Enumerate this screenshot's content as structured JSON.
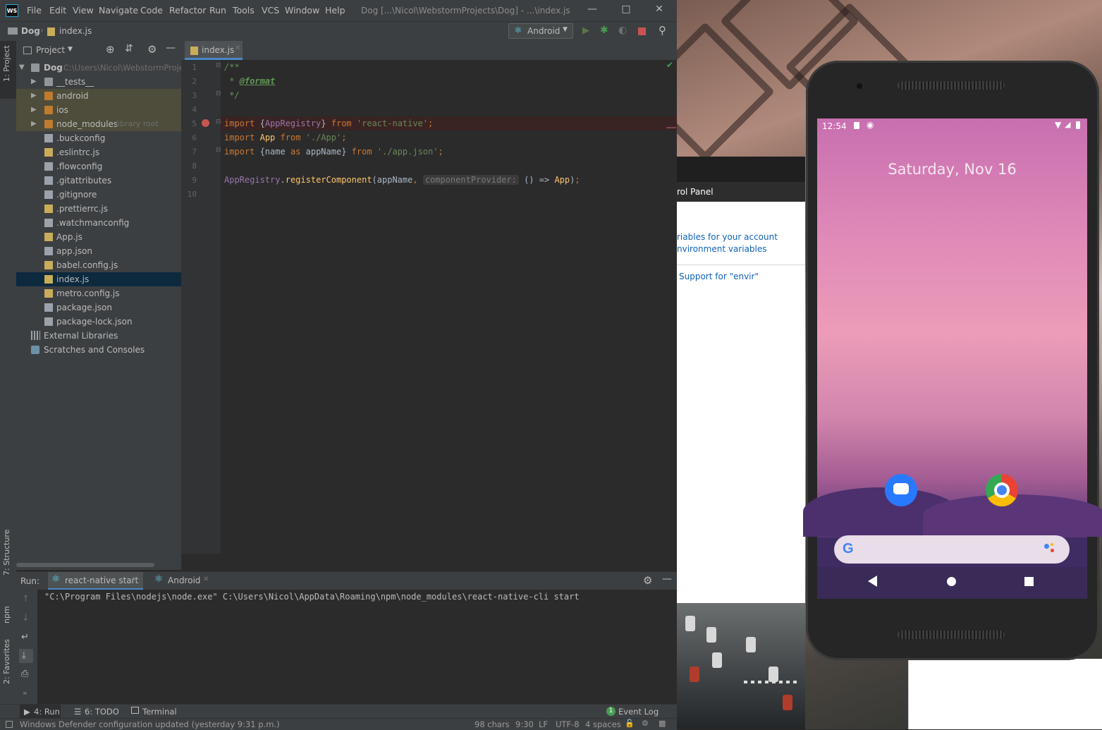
{
  "menubar": {
    "app_icon": "WS",
    "items": [
      "File",
      "Edit",
      "View",
      "Navigate",
      "Code",
      "Refactor",
      "Run",
      "Tools",
      "VCS",
      "Window",
      "Help"
    ],
    "title": "Dog [...\\Nicol\\WebstormProjects\\Dog] - ...\\index.js"
  },
  "navbar": {
    "crumb_project": "Dog",
    "crumb_file": "index.js",
    "run_config": "Android"
  },
  "leftstrip": {
    "project_tab": "1: Project",
    "structure_tab": "7: Structure",
    "npm_tab": "npm",
    "favorites_tab": "2: Favorites"
  },
  "project_panel": {
    "header": "Project",
    "root_name": "Dog",
    "root_path": "C:\\Users\\Nicol\\WebstormProje",
    "items": [
      {
        "label": "__tests__",
        "type": "folder"
      },
      {
        "label": "android",
        "type": "folder"
      },
      {
        "label": "ios",
        "type": "folder"
      },
      {
        "label": "node_modules",
        "type": "folder",
        "suffix": "library root"
      },
      {
        "label": ".buckconfig",
        "type": "file"
      },
      {
        "label": ".eslintrc.js",
        "type": "file"
      },
      {
        "label": ".flowconfig",
        "type": "file"
      },
      {
        "label": ".gitattributes",
        "type": "file"
      },
      {
        "label": ".gitignore",
        "type": "file"
      },
      {
        "label": ".prettierrc.js",
        "type": "file"
      },
      {
        "label": ".watchmanconfig",
        "type": "file"
      },
      {
        "label": "App.js",
        "type": "file"
      },
      {
        "label": "app.json",
        "type": "file"
      },
      {
        "label": "babel.config.js",
        "type": "file"
      },
      {
        "label": "index.js",
        "type": "file",
        "selected": true
      },
      {
        "label": "metro.config.js",
        "type": "file"
      },
      {
        "label": "package.json",
        "type": "file"
      },
      {
        "label": "package-lock.json",
        "type": "file"
      }
    ],
    "external_libraries": "External Libraries",
    "scratches": "Scratches and Consoles"
  },
  "editor": {
    "tab": "index.js",
    "line_numbers": [
      "1",
      "2",
      "3",
      "4",
      "5",
      "6",
      "7",
      "8",
      "9",
      "10"
    ],
    "hint_param": "componentProvider:"
  },
  "run_panel": {
    "label": "Run:",
    "tab1": "react-native start",
    "tab2": "Android",
    "console_line": "\"C:\\Program Files\\nodejs\\node.exe\" C:\\Users\\Nicol\\AppData\\Roaming\\npm\\node_modules\\react-native-cli start"
  },
  "bottom_tabs": {
    "run": "4: Run",
    "todo": "6: TODO",
    "terminal": "Terminal",
    "event_log": "Event Log",
    "event_count": "1"
  },
  "status_bar": {
    "message": "Windows Defender configuration updated (yesterday 9:31 p.m.)",
    "chars": "98 chars",
    "position": "9:30",
    "line_sep": "LF",
    "encoding": "UTF-8",
    "indent": "4 spaces"
  },
  "control_panel": {
    "title": "rol Panel",
    "link1": "riables for your account",
    "link2": "nvironment variables",
    "link3": "Support for \"envir\""
  },
  "phone": {
    "time": "12:54",
    "date": "Saturday, Nov 16"
  },
  "colors": {
    "accent": "#4a88c7",
    "selection": "#0d293e",
    "breakpoint": "#c75450"
  }
}
